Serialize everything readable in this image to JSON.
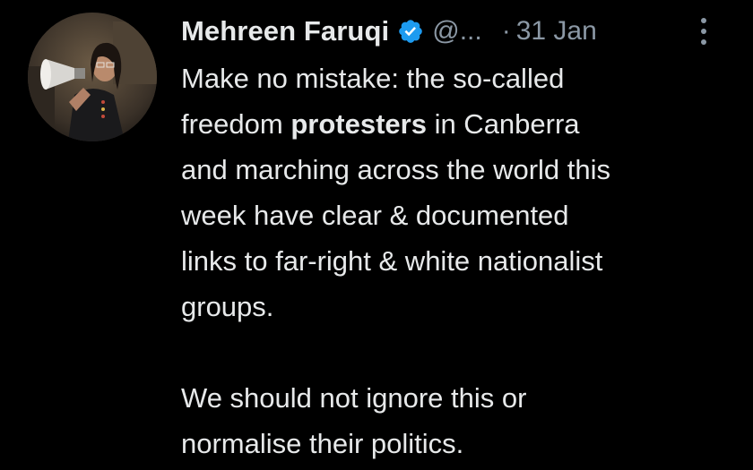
{
  "tweet": {
    "author": {
      "name": "Mehreen Faruqi",
      "handle": "@...",
      "verified_icon": "verified-badge-icon"
    },
    "separator": "·",
    "date": "31 Jan",
    "more_icon": "more-vertical-icon",
    "text": {
      "line1": "Make no mistake: the so-called",
      "line2_before": "freedom ",
      "line2_bold": "protesters",
      "line2_after": " in Canberra",
      "line3": "and marching across the world this",
      "line4": "week have clear & documented",
      "line5": "links to far-right & white nationalist",
      "line6": "groups.",
      "line7": "We should not ignore this or",
      "line8": "normalise their politics."
    }
  },
  "colors": {
    "background": "#000000",
    "primary_text": "#e7e9ea",
    "secondary_text": "#8b98a5",
    "verified_blue": "#1d9bf0"
  }
}
